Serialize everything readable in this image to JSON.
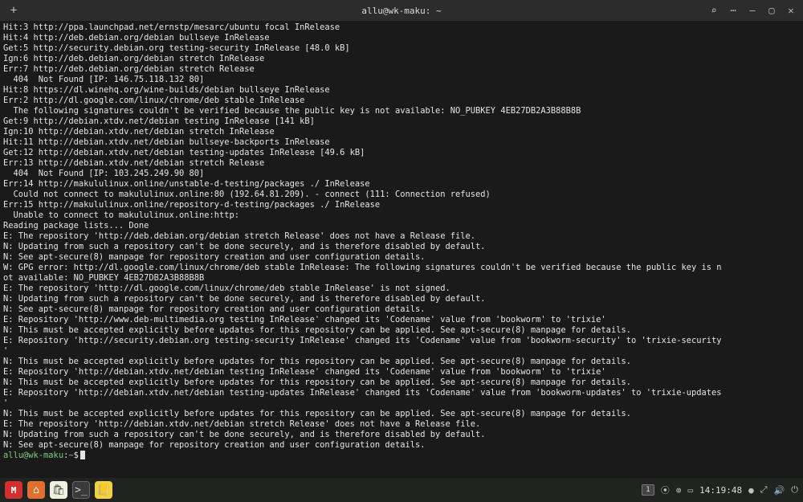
{
  "window": {
    "title": "allu@wk-maku: ~"
  },
  "terminal": {
    "lines": [
      "Hit:3 http://ppa.launchpad.net/ernstp/mesarc/ubuntu focal InRelease",
      "Hit:4 http://deb.debian.org/debian bullseye InRelease",
      "Get:5 http://security.debian.org testing-security InRelease [48.0 kB]",
      "Ign:6 http://deb.debian.org/debian stretch InRelease",
      "Err:7 http://deb.debian.org/debian stretch Release",
      "  404  Not Found [IP: 146.75.118.132 80]",
      "Hit:8 https://dl.winehq.org/wine-builds/debian bullseye InRelease",
      "Err:2 http://dl.google.com/linux/chrome/deb stable InRelease",
      "  The following signatures couldn't be verified because the public key is not available: NO_PUBKEY 4EB27DB2A3B88B8B",
      "Get:9 http://debian.xtdv.net/debian testing InRelease [141 kB]",
      "Ign:10 http://debian.xtdv.net/debian stretch InRelease",
      "Hit:11 http://debian.xtdv.net/debian bullseye-backports InRelease",
      "Get:12 http://debian.xtdv.net/debian testing-updates InRelease [49.6 kB]",
      "Err:13 http://debian.xtdv.net/debian stretch Release",
      "  404  Not Found [IP: 103.245.249.90 80]",
      "Err:14 http://makululinux.online/unstable-d-testing/packages ./ InRelease",
      "  Could not connect to makululinux.online:80 (192.64.81.209). - connect (111: Connection refused)",
      "Err:15 http://makululinux.online/repository-d-testing/packages ./ InRelease",
      "  Unable to connect to makululinux.online:http:",
      "Reading package lists... Done",
      "E: The repository 'http://deb.debian.org/debian stretch Release' does not have a Release file.",
      "N: Updating from such a repository can't be done securely, and is therefore disabled by default.",
      "N: See apt-secure(8) manpage for repository creation and user configuration details.",
      "W: GPG error: http://dl.google.com/linux/chrome/deb stable InRelease: The following signatures couldn't be verified because the public key is n",
      "ot available: NO_PUBKEY 4EB27DB2A3B88B8B",
      "E: The repository 'http://dl.google.com/linux/chrome/deb stable InRelease' is not signed.",
      "N: Updating from such a repository can't be done securely, and is therefore disabled by default.",
      "N: See apt-secure(8) manpage for repository creation and user configuration details.",
      "E: Repository 'http://www.deb-multimedia.org testing InRelease' changed its 'Codename' value from 'bookworm' to 'trixie'",
      "N: This must be accepted explicitly before updates for this repository can be applied. See apt-secure(8) manpage for details.",
      "E: Repository 'http://security.debian.org testing-security InRelease' changed its 'Codename' value from 'bookworm-security' to 'trixie-security",
      "'",
      "N: This must be accepted explicitly before updates for this repository can be applied. See apt-secure(8) manpage for details.",
      "E: Repository 'http://debian.xtdv.net/debian testing InRelease' changed its 'Codename' value from 'bookworm' to 'trixie'",
      "N: This must be accepted explicitly before updates for this repository can be applied. See apt-secure(8) manpage for details.",
      "E: Repository 'http://debian.xtdv.net/debian testing-updates InRelease' changed its 'Codename' value from 'bookworm-updates' to 'trixie-updates",
      "'",
      "N: This must be accepted explicitly before updates for this repository can be applied. See apt-secure(8) manpage for details.",
      "E: The repository 'http://debian.xtdv.net/debian stretch Release' does not have a Release file.",
      "N: Updating from such a repository can't be done securely, and is therefore disabled by default.",
      "N: See apt-secure(8) manpage for repository creation and user configuration details."
    ],
    "prompt": {
      "user": "allu@wk-maku",
      "sep": ":",
      "path": "~",
      "dollar": "$"
    }
  },
  "taskbar": {
    "icons": {
      "mega": "M",
      "orange": "⌂",
      "software": "🛍",
      "terminal": ">_",
      "notes": "📒"
    },
    "right": {
      "workspace": "1",
      "accessibility": "⦿",
      "wifi": "⊚",
      "battery": "▭",
      "clock": "14:19:48",
      "record": "●",
      "expand": "⤢",
      "volume": "🔊",
      "power": "⏻"
    }
  }
}
